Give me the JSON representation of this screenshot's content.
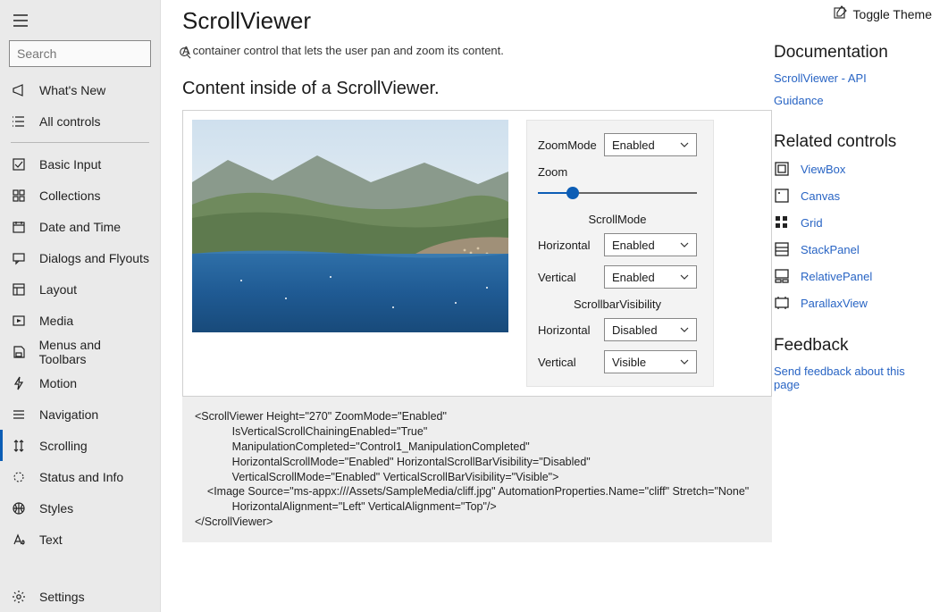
{
  "sidebar": {
    "search_placeholder": "Search",
    "top_items": [
      {
        "label": "What's New",
        "icon": "megaphone"
      },
      {
        "label": "All controls",
        "icon": "list"
      }
    ],
    "groups": [
      {
        "label": "Basic Input",
        "icon": "checkbox"
      },
      {
        "label": "Collections",
        "icon": "grid"
      },
      {
        "label": "Date and Time",
        "icon": "calendar"
      },
      {
        "label": "Dialogs and Flyouts",
        "icon": "chat"
      },
      {
        "label": "Layout",
        "icon": "layout"
      },
      {
        "label": "Media",
        "icon": "media"
      },
      {
        "label": "Menus and Toolbars",
        "icon": "save"
      },
      {
        "label": "Motion",
        "icon": "bolt"
      },
      {
        "label": "Navigation",
        "icon": "lines"
      },
      {
        "label": "Scrolling",
        "icon": "scroll",
        "selected": true
      },
      {
        "label": "Status and Info",
        "icon": "dots"
      },
      {
        "label": "Styles",
        "icon": "globe"
      },
      {
        "label": "Text",
        "icon": "text"
      }
    ],
    "footer": {
      "label": "Settings",
      "icon": "gear"
    }
  },
  "header": {
    "toggle_theme": "Toggle Theme"
  },
  "page": {
    "title": "ScrollViewer",
    "description": "A container control that lets the user pan and zoom its content.",
    "section_title": "Content inside of a ScrollViewer."
  },
  "controls": {
    "zoommode_label": "ZoomMode",
    "zoommode_value": "Enabled",
    "zoom_label": "Zoom",
    "scrollmode_header": "ScrollMode",
    "h_label": "Horizontal",
    "h_value": "Enabled",
    "v_label": "Vertical",
    "v_value": "Enabled",
    "scrollbarvis_header": "ScrollbarVisibility",
    "sbv_h_label": "Horizontal",
    "sbv_h_value": "Disabled",
    "sbv_v_label": "Vertical",
    "sbv_v_value": "Visible"
  },
  "code": "<ScrollViewer Height=\"270\" ZoomMode=\"Enabled\"\n            IsVerticalScrollChainingEnabled=\"True\"\n            ManipulationCompleted=\"Control1_ManipulationCompleted\"\n            HorizontalScrollMode=\"Enabled\" HorizontalScrollBarVisibility=\"Disabled\"\n            VerticalScrollMode=\"Enabled\" VerticalScrollBarVisibility=\"Visible\">\n    <Image Source=\"ms-appx:///Assets/SampleMedia/cliff.jpg\" AutomationProperties.Name=\"cliff\" Stretch=\"None\"\n            HorizontalAlignment=\"Left\" VerticalAlignment=\"Top\"/>\n</ScrollViewer>",
  "right": {
    "doc_header": "Documentation",
    "doc_links": [
      "ScrollViewer - API",
      "Guidance"
    ],
    "related_header": "Related controls",
    "related": [
      {
        "label": "ViewBox"
      },
      {
        "label": "Canvas"
      },
      {
        "label": "Grid"
      },
      {
        "label": "StackPanel"
      },
      {
        "label": "RelativePanel"
      },
      {
        "label": "ParallaxView"
      }
    ],
    "feedback_header": "Feedback",
    "feedback_link": "Send feedback about this page"
  }
}
